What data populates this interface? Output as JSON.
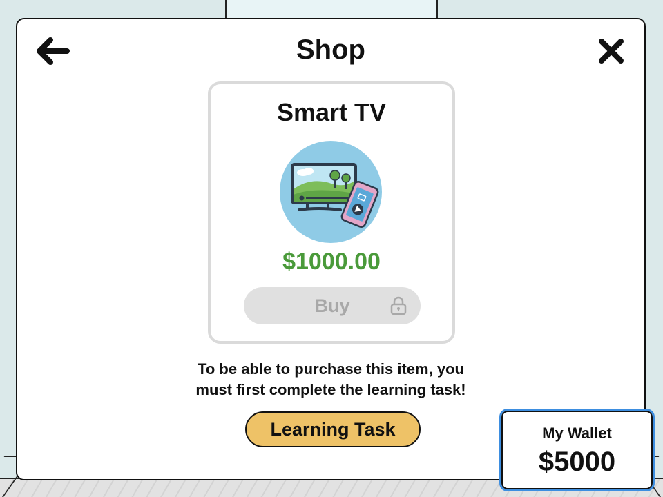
{
  "shop": {
    "title": "Shop",
    "back_icon": "arrow-left-icon",
    "close_icon": "close-icon"
  },
  "item": {
    "name": "Smart TV",
    "image_icon": "smart-tv-icon",
    "price": "$1000.00",
    "price_color": "#4a9a3a",
    "buy_label": "Buy",
    "buy_locked": true,
    "lock_icon": "lock-icon"
  },
  "notice": {
    "line1": "To be able to purchase this item, you",
    "line2": "must first complete the learning task!"
  },
  "learning_task": {
    "label": "Learning Task",
    "color": "#eec267"
  },
  "wallet": {
    "label": "My Wallet",
    "amount": "$5000",
    "border_color": "#3d8ee0"
  }
}
